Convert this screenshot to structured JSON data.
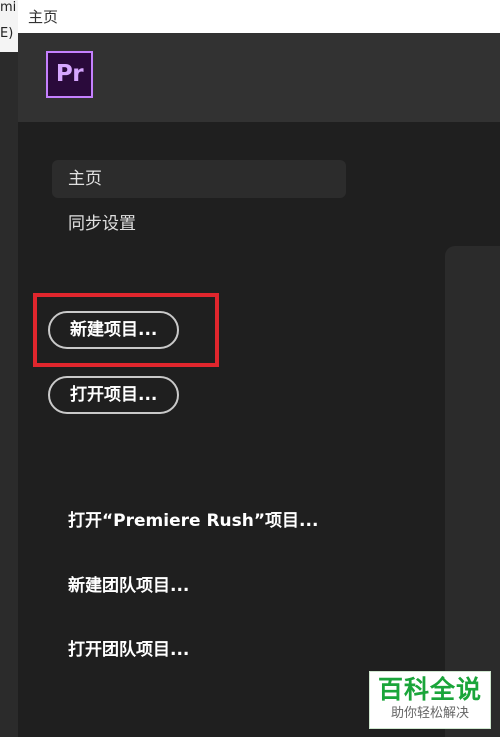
{
  "background_window": {
    "line1": "mi",
    "line2": "E)"
  },
  "titlebar": {
    "title": "主页"
  },
  "logo": {
    "text": "Pr",
    "border_color": "#c580ff",
    "bg_color": "#2a0a3b"
  },
  "sidebar": {
    "items": [
      {
        "label": "主页",
        "active": true
      },
      {
        "label": "同步设置",
        "active": false
      }
    ]
  },
  "actions": {
    "new_project": "新建项目...",
    "open_project": "打开项目..."
  },
  "links": [
    {
      "label": "打开“Premiere Rush”项目..."
    },
    {
      "label": "新建团队项目..."
    },
    {
      "label": "打开团队项目..."
    }
  ],
  "highlight": {
    "color": "#e0262d"
  },
  "watermark": {
    "title": "百科全说",
    "subtitle": "助你轻松解决"
  }
}
